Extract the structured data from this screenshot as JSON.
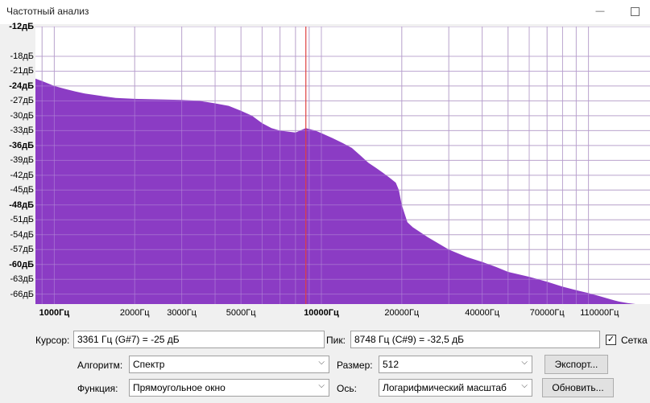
{
  "window": {
    "title": "Частотный анализ"
  },
  "chart_data": {
    "type": "area",
    "xscale": "log",
    "x_unit": "Гц",
    "y_unit": "дБ",
    "xlim": [
      850,
      170000
    ],
    "ylim": [
      -68,
      -12
    ],
    "fill_color": "#8b3cc4",
    "cursor_line_x": 8748,
    "grid": true,
    "y_ticks": [
      {
        "v": -12,
        "label": "-12дБ",
        "bold": true
      },
      {
        "v": -18,
        "label": "-18дБ"
      },
      {
        "v": -21,
        "label": "-21дБ"
      },
      {
        "v": -24,
        "label": "-24дБ",
        "bold": true
      },
      {
        "v": -27,
        "label": "-27дБ"
      },
      {
        "v": -30,
        "label": "-30дБ"
      },
      {
        "v": -33,
        "label": "-33дБ"
      },
      {
        "v": -36,
        "label": "-36дБ",
        "bold": true
      },
      {
        "v": -39,
        "label": "-39дБ"
      },
      {
        "v": -42,
        "label": "-42дБ"
      },
      {
        "v": -45,
        "label": "-45дБ"
      },
      {
        "v": -48,
        "label": "-48дБ",
        "bold": true
      },
      {
        "v": -51,
        "label": "-51дБ"
      },
      {
        "v": -54,
        "label": "-54дБ"
      },
      {
        "v": -57,
        "label": "-57дБ"
      },
      {
        "v": -60,
        "label": "-60дБ",
        "bold": true
      },
      {
        "v": -63,
        "label": "-63дБ"
      },
      {
        "v": -66,
        "label": "-66дБ"
      }
    ],
    "x_ticks": [
      {
        "v": 1000,
        "label": "1000Гц",
        "bold": true
      },
      {
        "v": 2000,
        "label": "2000Гц"
      },
      {
        "v": 3000,
        "label": "3000Гц"
      },
      {
        "v": 5000,
        "label": "5000Гц"
      },
      {
        "v": 10000,
        "label": "10000Гц",
        "bold": true
      },
      {
        "v": 20000,
        "label": "20000Гц"
      },
      {
        "v": 40000,
        "label": "40000Гц"
      },
      {
        "v": 70000,
        "label": "70000Гц"
      },
      {
        "v": 110000,
        "label": "110000Гц"
      }
    ],
    "x_gridlines": [
      900,
      1000,
      2000,
      3000,
      4000,
      5000,
      6000,
      7000,
      8000,
      9000,
      10000,
      20000,
      30000,
      40000,
      50000,
      60000,
      70000,
      80000,
      90000,
      100000
    ],
    "x": [
      850,
      900,
      1000,
      1100,
      1200,
      1300,
      1500,
      1700,
      2000,
      2500,
      3000,
      3500,
      4000,
      4500,
      5000,
      5500,
      6000,
      6500,
      7000,
      7500,
      8000,
      8748,
      9500,
      10000,
      11000,
      12000,
      13000,
      14000,
      15000,
      16000,
      17000,
      18000,
      19000,
      19500,
      20000,
      21000,
      22000,
      25000,
      30000,
      35000,
      40000,
      45000,
      50000,
      60000,
      70000,
      80000,
      90000,
      100000,
      110000,
      120000,
      130000,
      140000,
      150000,
      160000,
      170000
    ],
    "y": [
      -22.5,
      -23,
      -24,
      -24.6,
      -25.1,
      -25.5,
      -26,
      -26.4,
      -26.6,
      -26.7,
      -26.8,
      -27,
      -27.5,
      -28,
      -29,
      -30,
      -31.5,
      -32.5,
      -33,
      -33.2,
      -33.4,
      -32.5,
      -33,
      -33.5,
      -34.5,
      -35.5,
      -36.5,
      -38,
      -39.5,
      -40.5,
      -41.5,
      -42.5,
      -43.5,
      -45,
      -48,
      -51.5,
      -52.5,
      -54.5,
      -57,
      -58.5,
      -59.5,
      -60.5,
      -61.5,
      -62.5,
      -63.5,
      -64.5,
      -65.2,
      -65.8,
      -66.4,
      -67,
      -67.5,
      -67.8,
      -68,
      -68,
      -68
    ]
  },
  "controls": {
    "cursor_label": "Курсор:",
    "cursor_value": "3361 Гц (G#7) = -25 дБ",
    "peak_label": "Пик:",
    "peak_value": "8748 Гц (C#9) = -32,5 дБ",
    "grid_label": "Сетка",
    "grid_checked": true,
    "algorithm_label": "Алгоритм:",
    "algorithm_value": "Спектр",
    "size_label": "Размер:",
    "size_value": "512",
    "export_label": "Экспорт...",
    "function_label": "Функция:",
    "function_value": "Прямоугольное  окно",
    "axis_label": "Ось:",
    "axis_value": "Логарифмический масштаб",
    "update_label": "Обновить..."
  }
}
